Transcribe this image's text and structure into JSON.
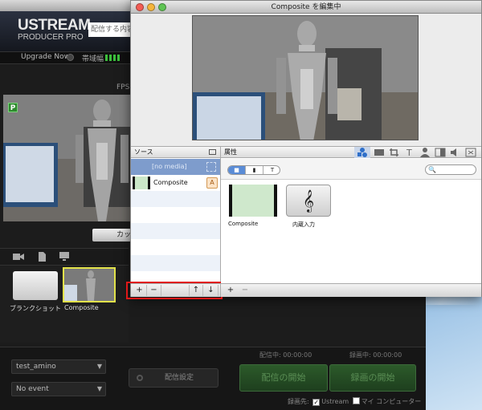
{
  "main": {
    "logo_line1": "USTREAM",
    "logo_line2": "PRODUCER PRO",
    "title_input_value": "配信する内容",
    "upgrade_label": "Upgrade Now",
    "bandwidth_label": "帯域幅",
    "fps_label": "FPS:",
    "preview_badge": "P",
    "cut_button": "カット",
    "shots": [
      {
        "label": "ブランクショット"
      },
      {
        "label": "Composite"
      }
    ],
    "dropdown_account": "test_amino",
    "dropdown_event": "No event",
    "stream_settings_button": "配信設定",
    "streaming_time": "配信中: 00:00:00",
    "recording_time": "録画中: 00:00:00",
    "start_stream_button": "配信の開始",
    "start_record_button": "録画の開始",
    "record_target_label": "録画先:",
    "record_target_ustream": "Ustream",
    "record_target_local": "マイ コンピューター",
    "record_target_ustream_checked": true,
    "record_target_local_checked": false,
    "bandwidth_bars": 4
  },
  "composite_window": {
    "title": "Composite を編集中",
    "sources_header": "ソース",
    "properties_header": "属性",
    "sources": [
      {
        "label": "[no media]",
        "selected": true
      },
      {
        "label": "Composite",
        "selected": false
      }
    ],
    "source_toolbar": {
      "add": "+",
      "remove": "−",
      "move_up": "↑",
      "move_down": "↓"
    },
    "segment": {
      "camera": "■",
      "document": "▮",
      "text": "T"
    },
    "media_tiles": [
      {
        "label": "Composite"
      },
      {
        "label": "内蔵入力"
      }
    ],
    "audio_glyph": "𝄞",
    "prop_toolbar": {
      "add": "+",
      "remove": "−"
    },
    "text_add_glyph": "A",
    "search_glyph": "🔍"
  },
  "colors": {
    "accent_selection": "#7e9ccc",
    "highlight_box": "#e01818",
    "start_button": "#2c5a2a",
    "thumb_border": "#e2e24a"
  }
}
